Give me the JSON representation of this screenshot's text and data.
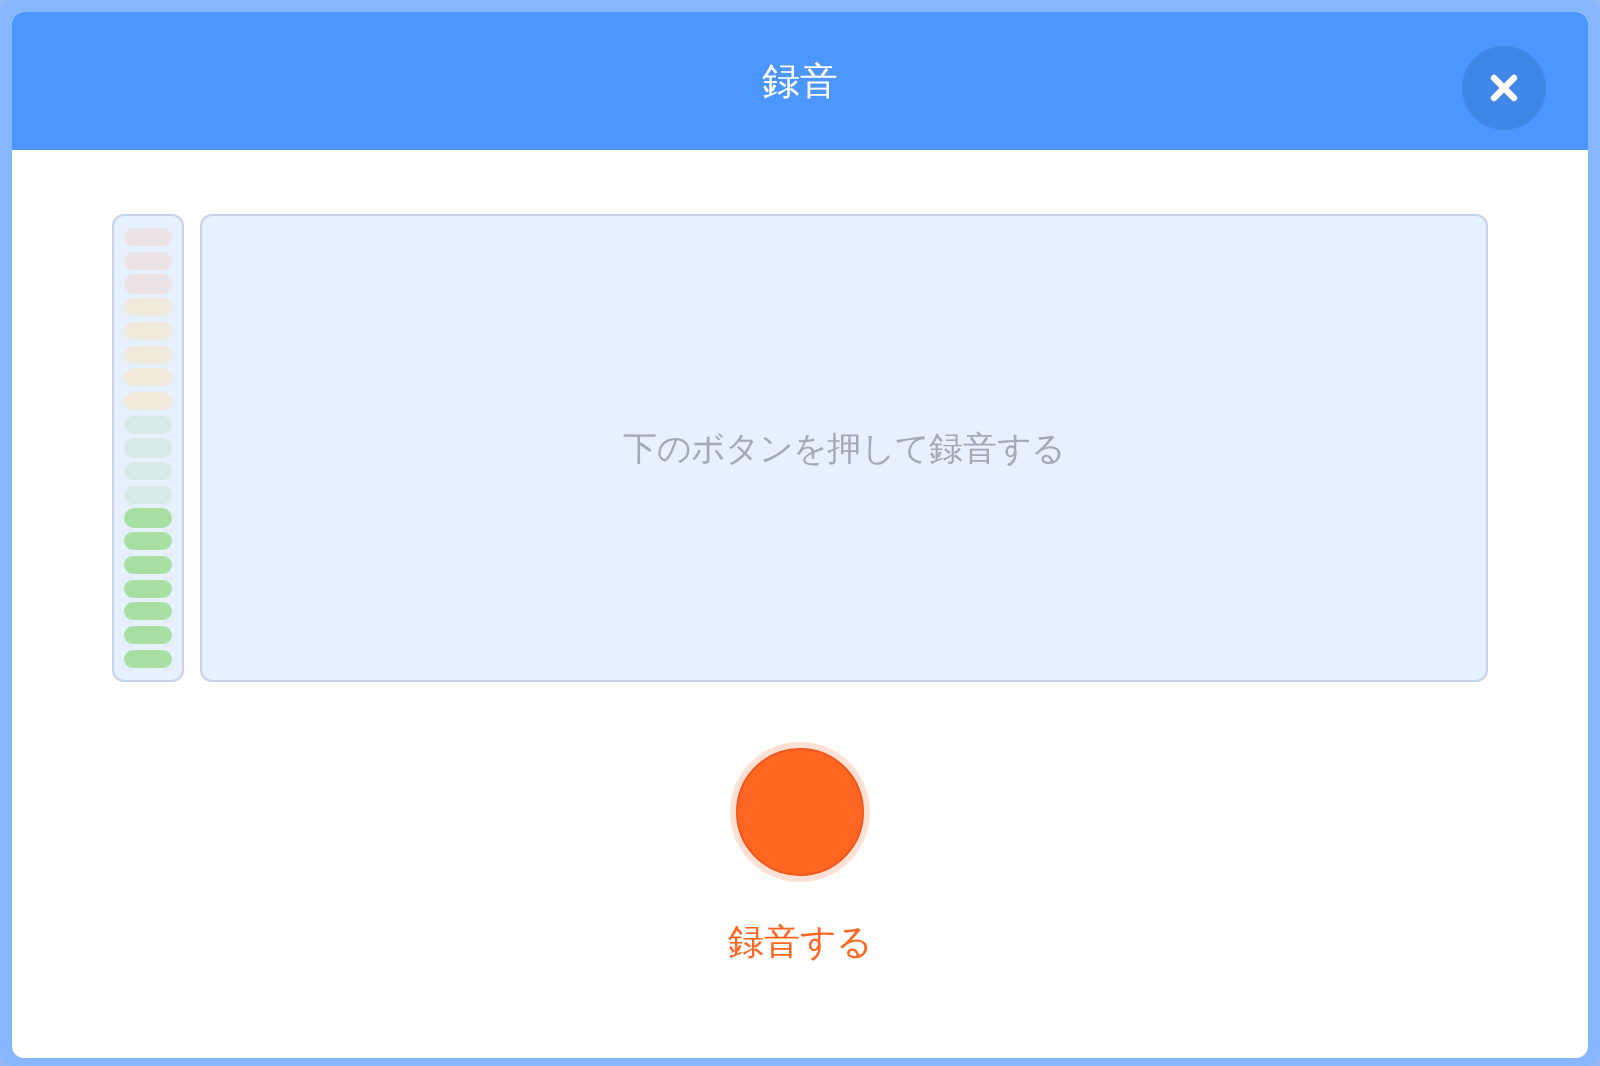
{
  "window": {
    "title": "録音"
  },
  "meter": {
    "level": 0.37
  },
  "preview": {
    "hint": "下のボタンを押して録音する"
  },
  "record_button": {
    "label": "録音する"
  }
}
